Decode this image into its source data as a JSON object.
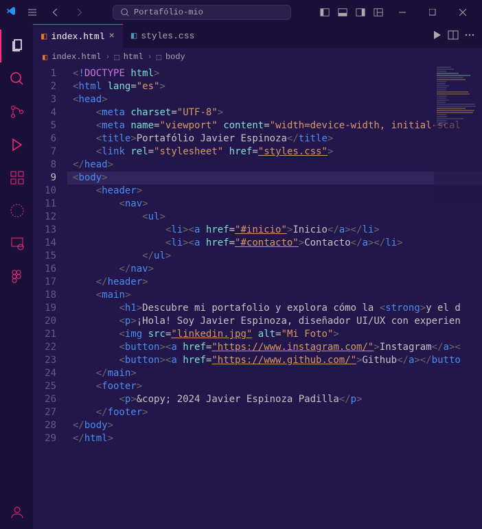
{
  "titlebar": {
    "search_text": "Portafólio-mio"
  },
  "tabs": [
    {
      "label": "index.html",
      "active": true,
      "icon": "html"
    },
    {
      "label": "styles.css",
      "active": false,
      "icon": "css"
    }
  ],
  "breadcrumb": [
    {
      "label": "index.html",
      "icon": "html"
    },
    {
      "label": "html",
      "icon": "tag"
    },
    {
      "label": "body",
      "icon": "tag"
    }
  ],
  "code": {
    "active_line": 9,
    "lines": [
      {
        "n": 1,
        "html": "<span class='bracket'>&lt;</span><span class='doctype'>!</span><span class='doctype-kw'>DOCTYPE</span> <span class='attr'>html</span><span class='bracket'>&gt;</span>"
      },
      {
        "n": 2,
        "html": "<span class='bracket'>&lt;</span><span class='tag'>html</span> <span class='attr'>lang</span>=<span class='string'>\"es\"</span><span class='bracket'>&gt;</span>"
      },
      {
        "n": 3,
        "html": "<span class='bracket'>&lt;</span><span class='tag'>head</span><span class='bracket'>&gt;</span>"
      },
      {
        "n": 4,
        "html": "    <span class='bracket'>&lt;</span><span class='tag'>meta</span> <span class='attr'>charset</span>=<span class='string'>\"UTF-8\"</span><span class='bracket'>&gt;</span>"
      },
      {
        "n": 5,
        "html": "    <span class='bracket'>&lt;</span><span class='tag'>meta</span> <span class='attr'>name</span>=<span class='string'>\"viewport\"</span> <span class='attr'>content</span>=<span class='string'>\"width=device-width, initial-scal</span>"
      },
      {
        "n": 6,
        "html": "    <span class='bracket'>&lt;</span><span class='tag'>title</span><span class='bracket'>&gt;</span><span class='text'>Portafólio Javier Espinoza</span><span class='bracket'>&lt;/</span><span class='tag'>title</span><span class='bracket'>&gt;</span>"
      },
      {
        "n": 7,
        "html": "    <span class='bracket'>&lt;</span><span class='tag'>link</span> <span class='attr'>rel</span>=<span class='string'>\"stylesheet\"</span> <span class='attr'>href</span>=<span class='string underline'>\"styles.css\"</span><span class='bracket'>&gt;</span>"
      },
      {
        "n": 8,
        "html": "<span class='bracket'>&lt;/</span><span class='tag'>head</span><span class='bracket'>&gt;</span>"
      },
      {
        "n": 9,
        "html": "<span class='bracket'>&lt;</span><span class='tag'>body</span><span class='bracket'>&gt;</span>"
      },
      {
        "n": 10,
        "html": "    <span class='bracket'>&lt;</span><span class='tag'>header</span><span class='bracket'>&gt;</span>"
      },
      {
        "n": 11,
        "html": "        <span class='bracket'>&lt;</span><span class='tag'>nav</span><span class='bracket'>&gt;</span>"
      },
      {
        "n": 12,
        "html": "            <span class='bracket'>&lt;</span><span class='tag'>ul</span><span class='bracket'>&gt;</span>"
      },
      {
        "n": 13,
        "html": "                <span class='bracket'>&lt;</span><span class='tag'>li</span><span class='bracket'>&gt;&lt;</span><span class='tag'>a</span> <span class='attr'>href</span>=<span class='string underline'>\"#inicio\"</span><span class='bracket'>&gt;</span><span class='text'>Inicio</span><span class='bracket'>&lt;/</span><span class='tag'>a</span><span class='bracket'>&gt;&lt;/</span><span class='tag'>li</span><span class='bracket'>&gt;</span>"
      },
      {
        "n": 14,
        "html": "                <span class='bracket'>&lt;</span><span class='tag'>li</span><span class='bracket'>&gt;&lt;</span><span class='tag'>a</span> <span class='attr'>href</span>=<span class='string underline'>\"#contacto\"</span><span class='bracket'>&gt;</span><span class='text'>Contacto</span><span class='bracket'>&lt;/</span><span class='tag'>a</span><span class='bracket'>&gt;&lt;/</span><span class='tag'>li</span><span class='bracket'>&gt;</span>"
      },
      {
        "n": 15,
        "html": "            <span class='bracket'>&lt;/</span><span class='tag'>ul</span><span class='bracket'>&gt;</span>"
      },
      {
        "n": 16,
        "html": "        <span class='bracket'>&lt;/</span><span class='tag'>nav</span><span class='bracket'>&gt;</span>"
      },
      {
        "n": 17,
        "html": "    <span class='bracket'>&lt;/</span><span class='tag'>header</span><span class='bracket'>&gt;</span>"
      },
      {
        "n": 18,
        "html": "    <span class='bracket'>&lt;</span><span class='tag'>main</span><span class='bracket'>&gt;</span>"
      },
      {
        "n": 19,
        "html": "        <span class='bracket'>&lt;</span><span class='tag'>h1</span><span class='bracket'>&gt;</span><span class='text'>Descubre mi portafolio y explora cómo la </span><span class='bracket'>&lt;</span><span class='tag'>strong</span><span class='bracket'>&gt;</span><span class='text'>y el d</span>"
      },
      {
        "n": 20,
        "html": "        <span class='bracket'>&lt;</span><span class='tag'>p</span><span class='bracket'>&gt;</span><span class='text'>¡Hola! Soy Javier Espinoza, diseñador UI/UX con experien</span>"
      },
      {
        "n": 21,
        "html": "        <span class='bracket'>&lt;</span><span class='tag'>img</span> <span class='attr'>src</span>=<span class='string underline'>\"linkedin.jpg\"</span> <span class='attr'>alt</span>=<span class='string'>\"Mi Foto\"</span><span class='bracket'>&gt;</span>"
      },
      {
        "n": 22,
        "html": "        <span class='bracket'>&lt;</span><span class='tag'>button</span><span class='bracket'>&gt;&lt;</span><span class='tag'>a</span> <span class='attr'>href</span>=<span class='string underline'>\"https://www.instagram.com/\"</span><span class='bracket'>&gt;</span><span class='text'>Instagram</span><span class='bracket'>&lt;/</span><span class='tag'>a</span><span class='bracket'>&gt;&lt;</span>"
      },
      {
        "n": 23,
        "html": "        <span class='bracket'>&lt;</span><span class='tag'>button</span><span class='bracket'>&gt;&lt;</span><span class='tag'>a</span> <span class='attr'>href</span>=<span class='string underline'>\"https://www.github.com/\"</span><span class='bracket'>&gt;</span><span class='text'>Github</span><span class='bracket'>&lt;/</span><span class='tag'>a</span><span class='bracket'>&gt;&lt;/</span><span class='tag'>butto</span>"
      },
      {
        "n": 24,
        "html": "    <span class='bracket'>&lt;/</span><span class='tag'>main</span><span class='bracket'>&gt;</span>"
      },
      {
        "n": 25,
        "html": "    <span class='bracket'>&lt;</span><span class='tag'>footer</span><span class='bracket'>&gt;</span>"
      },
      {
        "n": 26,
        "html": "        <span class='bracket'>&lt;</span><span class='tag'>p</span><span class='bracket'>&gt;</span><span class='text'>&amp;copy; 2024 Javier Espinoza Padilla</span><span class='bracket'>&lt;/</span><span class='tag'>p</span><span class='bracket'>&gt;</span>"
      },
      {
        "n": 27,
        "html": "    <span class='bracket'>&lt;/</span><span class='tag'>footer</span><span class='bracket'>&gt;</span>"
      },
      {
        "n": 28,
        "html": "<span class='bracket'>&lt;/</span><span class='tag'>body</span><span class='bracket'>&gt;</span>"
      },
      {
        "n": 29,
        "html": "<span class='bracket'>&lt;/</span><span class='tag'>html</span><span class='bracket'>&gt;</span>"
      }
    ]
  }
}
